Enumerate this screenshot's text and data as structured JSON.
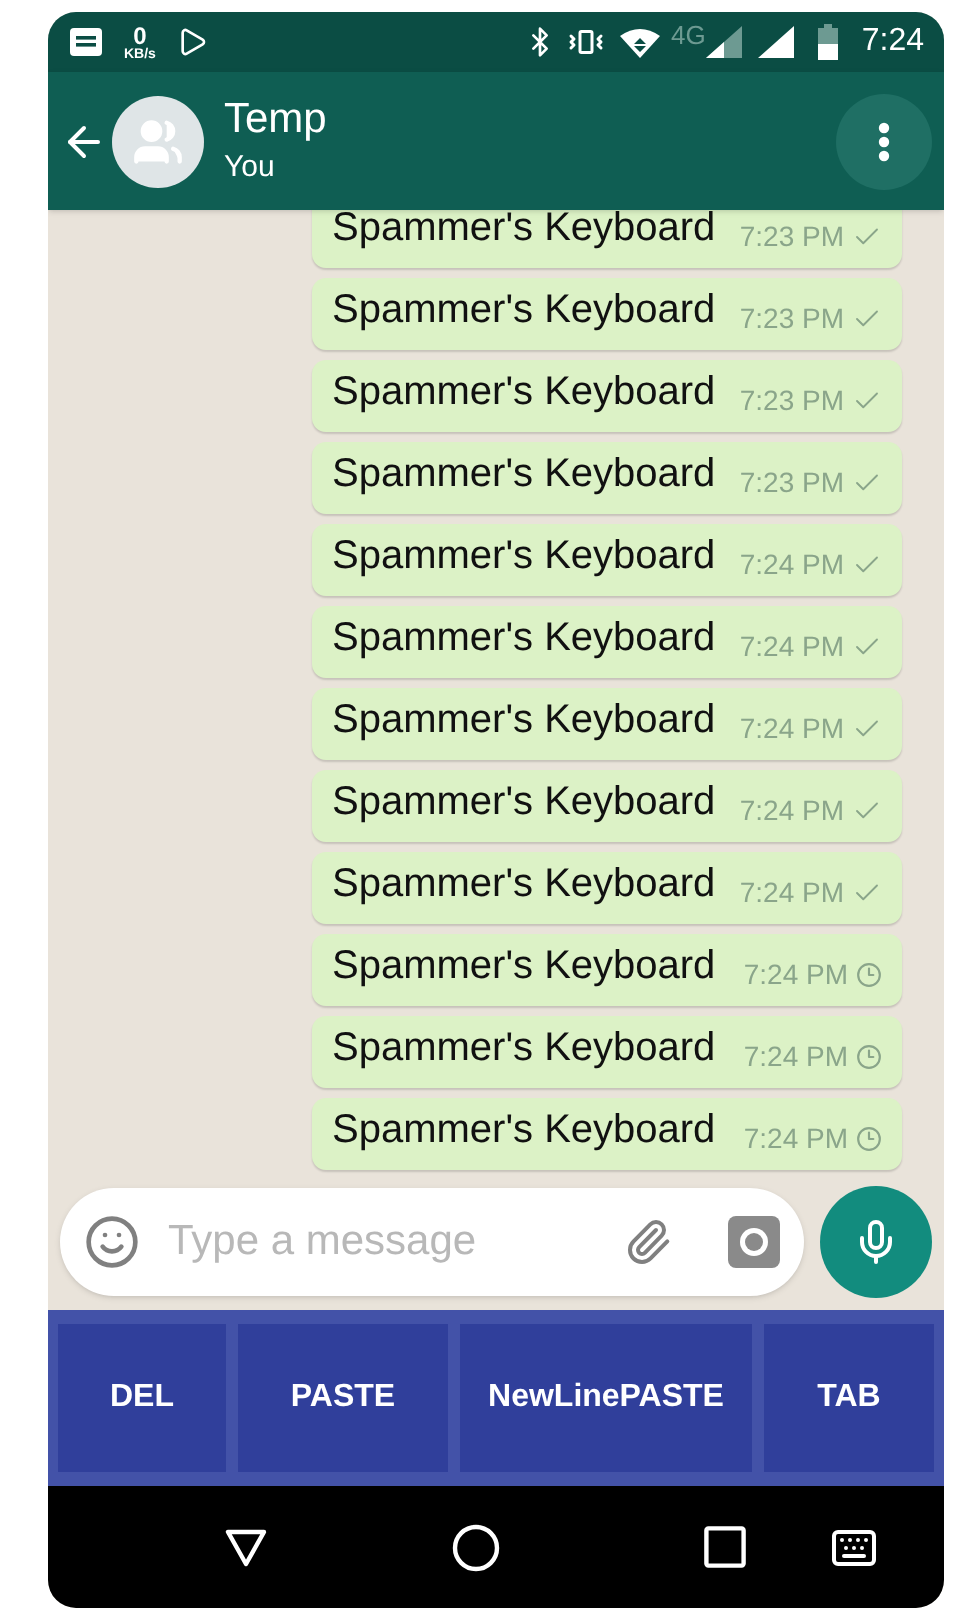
{
  "status_bar": {
    "speed_value": "0",
    "speed_unit": "KB/s",
    "network": "4G",
    "time": "7:24"
  },
  "header": {
    "title": "Temp",
    "subtitle": "You"
  },
  "messages": [
    {
      "text": "Spammer's Keyboard",
      "time": "7:23 PM",
      "sent": true
    },
    {
      "text": "Spammer's Keyboard",
      "time": "7:23 PM",
      "sent": true
    },
    {
      "text": "Spammer's Keyboard",
      "time": "7:23 PM",
      "sent": true
    },
    {
      "text": "Spammer's Keyboard",
      "time": "7:23 PM",
      "sent": true
    },
    {
      "text": "Spammer's Keyboard",
      "time": "7:24 PM",
      "sent": true
    },
    {
      "text": "Spammer's Keyboard",
      "time": "7:24 PM",
      "sent": true
    },
    {
      "text": "Spammer's Keyboard",
      "time": "7:24 PM",
      "sent": true
    },
    {
      "text": "Spammer's Keyboard",
      "time": "7:24 PM",
      "sent": true
    },
    {
      "text": "Spammer's Keyboard",
      "time": "7:24 PM",
      "sent": true
    },
    {
      "text": "Spammer's Keyboard",
      "time": "7:24 PM",
      "sent": false
    },
    {
      "text": "Spammer's Keyboard",
      "time": "7:24 PM",
      "sent": false
    },
    {
      "text": "Spammer's Keyboard",
      "time": "7:24 PM",
      "sent": false
    }
  ],
  "composer": {
    "placeholder": "Type a message"
  },
  "keyboard": {
    "keys": [
      "DEL",
      "PASTE",
      "NewLinePASTE",
      "TAB"
    ]
  }
}
